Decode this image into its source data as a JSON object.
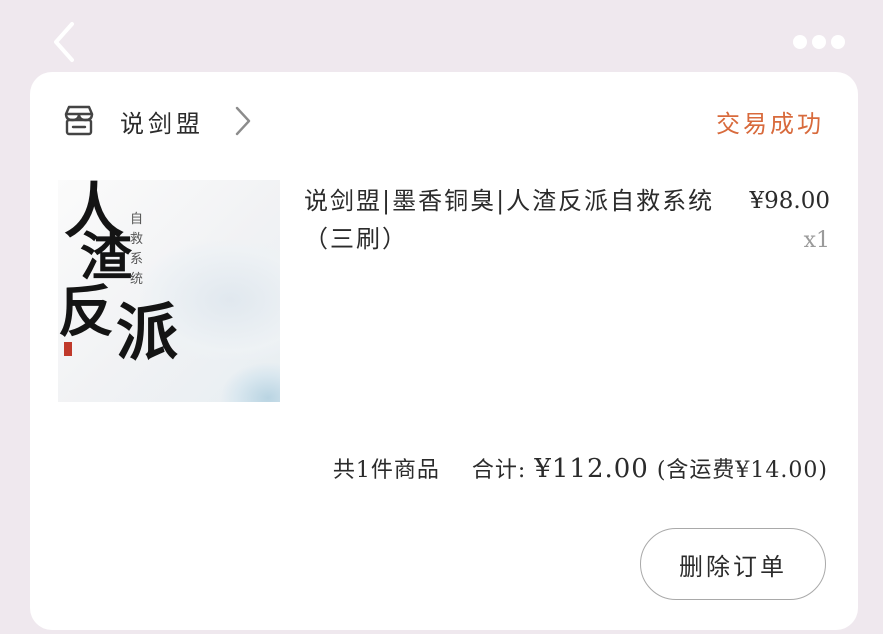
{
  "icons": {
    "back": "chevron-left-icon",
    "more": "more-dots-icon",
    "shop": "store-icon",
    "shop_chevron": "chevron-right-icon"
  },
  "colors": {
    "background": "#efe8ee",
    "card": "#ffffff",
    "status": "#d86a3c",
    "muted": "#9a9a9a"
  },
  "shop": {
    "name": "说剑盟"
  },
  "order": {
    "status": "交易成功",
    "item": {
      "title": "说剑盟|墨香铜臭|人渣反派自救系统（三刷）",
      "price": "¥98.00",
      "quantity": "x1",
      "cover_text": {
        "big": [
          "人",
          "渣",
          "反",
          "派"
        ],
        "small": "自救系统"
      }
    },
    "summary": {
      "count_text": "共1件商品",
      "total_label": "合计:",
      "total_value": "¥112.00",
      "shipping_note": "(含运费¥14.00)"
    },
    "actions": {
      "delete_label": "删除订单"
    }
  }
}
